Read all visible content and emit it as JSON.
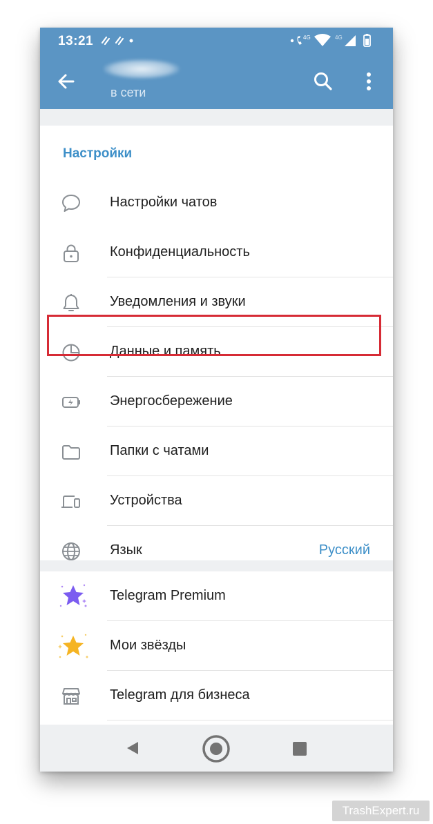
{
  "status_bar": {
    "time": "13:21",
    "network_label": "4G",
    "network_label_2": "4G"
  },
  "app_bar": {
    "subtitle": "в сети"
  },
  "settings": {
    "section_title": "Настройки",
    "items": [
      {
        "label": "Настройки чатов",
        "icon": "chat-bubble-icon"
      },
      {
        "label": "Конфиденциальность",
        "icon": "lock-icon"
      },
      {
        "label": "Уведомления и звуки",
        "icon": "bell-icon"
      },
      {
        "label": "Данные и память",
        "icon": "pie-chart-icon"
      },
      {
        "label": "Энергосбережение",
        "icon": "battery-icon"
      },
      {
        "label": "Папки с чатами",
        "icon": "folder-icon"
      },
      {
        "label": "Устройства",
        "icon": "devices-icon"
      },
      {
        "label": "Язык",
        "icon": "globe-icon",
        "value": "Русский"
      }
    ]
  },
  "extras": {
    "items": [
      {
        "label": "Telegram Premium",
        "icon": "premium-star-icon"
      },
      {
        "label": "Мои звёзды",
        "icon": "stars-icon"
      },
      {
        "label": "Telegram для бизнеса",
        "icon": "shop-icon"
      }
    ]
  },
  "watermark": "TrashExpert.ru",
  "colors": {
    "header": "#5b95c4",
    "accent": "#3d8fc8",
    "highlight_border": "#d62b35",
    "premium": "#7b5cf0",
    "stars": "#f5b423"
  }
}
